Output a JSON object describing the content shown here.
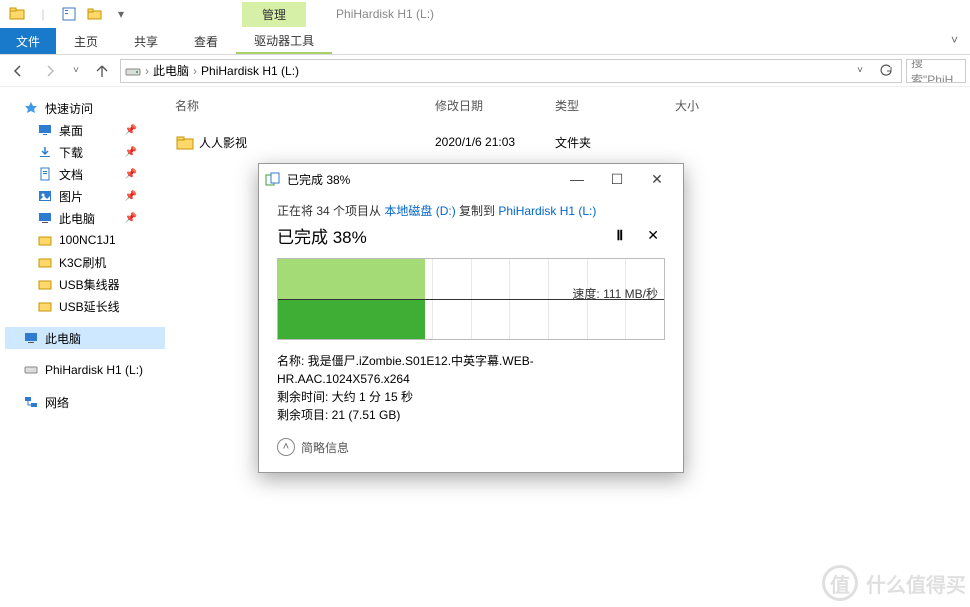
{
  "window": {
    "context_tab_label": "管理",
    "title": "PhiHardisk H1 (L:)"
  },
  "ribbon": {
    "file": "文件",
    "home": "主页",
    "share": "共享",
    "view": "查看",
    "drive_tools": "驱动器工具"
  },
  "address": {
    "root": "此电脑",
    "current": "PhiHardisk H1 (L:)",
    "search_placeholder": "搜索\"PhiH"
  },
  "sidebar": {
    "quick_access": "快速访问",
    "desktop": "桌面",
    "downloads": "下载",
    "documents": "文档",
    "pictures": "图片",
    "this_pc_quick": "此电脑",
    "f1": "100NC1J1",
    "f2": "K3C刷机",
    "f3": "USB集线器",
    "f4": "USB延长线",
    "this_pc": "此电脑",
    "drive": "PhiHardisk H1 (L:)",
    "network": "网络"
  },
  "columns": {
    "name": "名称",
    "date": "修改日期",
    "type": "类型",
    "size": "大小"
  },
  "files": [
    {
      "name": "人人影视",
      "date": "2020/1/6 21:03",
      "type": "文件夹",
      "size": ""
    }
  ],
  "dialog": {
    "title": "已完成 38%",
    "copy_prefix": "正在将 34 个项目从 ",
    "copy_src": "本地磁盘 (D:)",
    "copy_mid": " 复制到 ",
    "copy_dst": "PhiHardisk H1 (L:)",
    "completed": "已完成 38%",
    "speed": "速度: 111 MB/秒",
    "detail_name_label": "名称: ",
    "detail_name": "我是僵尸.iZombie.S01E12.中英字幕.WEB-HR.AAC.1024X576.x264",
    "detail_time_label": "剩余时间: ",
    "detail_time": "大约 1 分 15 秒",
    "detail_items_label": "剩余项目: ",
    "detail_items": "21 (7.51 GB)",
    "more": "简略信息"
  },
  "watermark": "什么值得买"
}
